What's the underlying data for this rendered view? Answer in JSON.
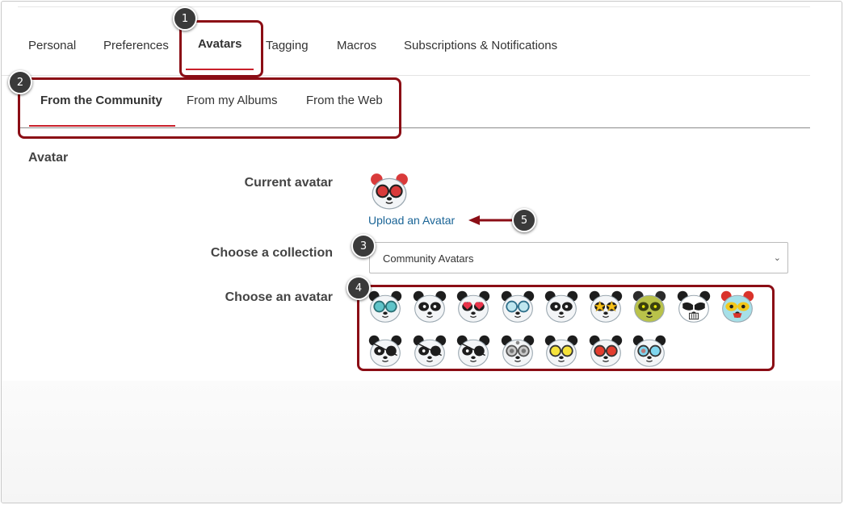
{
  "main_tabs": [
    {
      "label": "Personal"
    },
    {
      "label": "Preferences"
    },
    {
      "label": "Avatars",
      "active": true
    },
    {
      "label": "Tagging"
    },
    {
      "label": "Macros"
    },
    {
      "label": "Subscriptions & Notifications"
    }
  ],
  "sub_tabs": [
    {
      "label": "From the Community",
      "active": true
    },
    {
      "label": "From my Albums"
    },
    {
      "label": "From the Web"
    }
  ],
  "section_title": "Avatar",
  "labels": {
    "current_avatar": "Current avatar",
    "choose_collection": "Choose a collection",
    "choose_avatar": "Choose an avatar"
  },
  "upload_link": "Upload an Avatar",
  "collection_select": {
    "value": "Community Avatars"
  },
  "callouts": [
    "1",
    "2",
    "3",
    "4",
    "5"
  ],
  "accent_colors": {
    "tab_underline": "#c9202b",
    "callout": "#8b0d15",
    "link": "#1a6496"
  },
  "avatars": [
    {
      "icon": "panda-teal-glasses-icon",
      "eyes": "teal-glasses"
    },
    {
      "icon": "panda-plain-icon",
      "eyes": "plain"
    },
    {
      "icon": "panda-heart-eyes-icon",
      "eyes": "hearts"
    },
    {
      "icon": "panda-blue-glasses-icon",
      "eyes": "blue-glasses"
    },
    {
      "icon": "panda-plain-icon",
      "eyes": "plain"
    },
    {
      "icon": "panda-star-eyes-icon",
      "eyes": "stars"
    },
    {
      "icon": "panda-zombie-icon",
      "eyes": "zombie"
    },
    {
      "icon": "panda-stormtrooper-icon",
      "eyes": "trooper"
    },
    {
      "icon": "panda-luchador-icon",
      "eyes": "luchador"
    },
    {
      "icon": "panda-eyepatch-icon",
      "eyes": "eyepatch"
    },
    {
      "icon": "panda-eyepatch-icon",
      "eyes": "eyepatch"
    },
    {
      "icon": "panda-eyepatch-icon",
      "eyes": "eyepatch"
    },
    {
      "icon": "panda-steampunk-icon",
      "eyes": "gears"
    },
    {
      "icon": "panda-yellow-goggles-icon",
      "eyes": "yellow-goggles"
    },
    {
      "icon": "panda-red-goggles-icon",
      "eyes": "red-goggles"
    },
    {
      "icon": "panda-cyan-goggles-icon",
      "eyes": "cyan-goggles"
    }
  ],
  "current_avatar": {
    "icon": "panda-red-glasses-avatar-icon",
    "eyes": "red-glasses"
  }
}
